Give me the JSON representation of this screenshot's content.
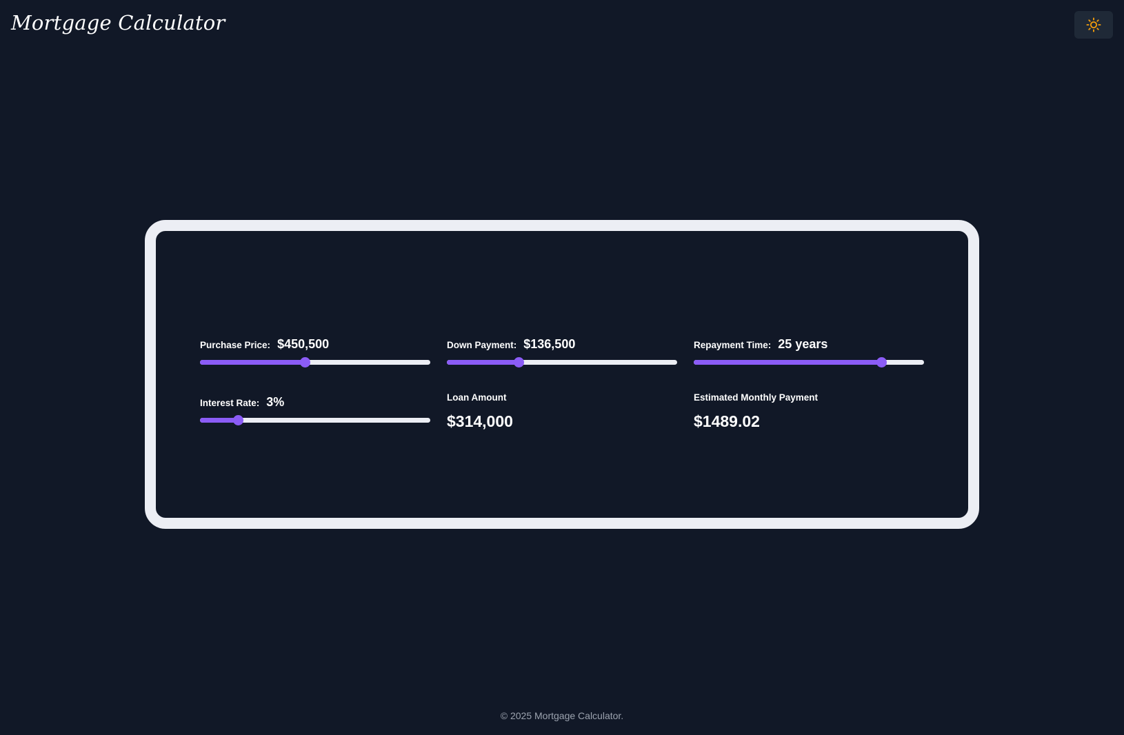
{
  "header": {
    "title": "Mortgage Calculator",
    "theme_toggle_icon": "sun-icon",
    "theme_toggle_color": "#f59e0b"
  },
  "calculator": {
    "purchase_price": {
      "label": "Purchase Price:",
      "value": "$450,500",
      "slider_fraction": 0.455
    },
    "down_payment": {
      "label": "Down Payment:",
      "value": "$136,500",
      "slider_fraction": 0.31
    },
    "repayment_time": {
      "label": "Repayment Time:",
      "value": "25 years",
      "slider_fraction": 0.815
    },
    "interest_rate": {
      "label": "Interest Rate:",
      "value": "3%",
      "slider_fraction": 0.165
    },
    "loan_amount": {
      "label": "Loan Amount",
      "value": "$314,000"
    },
    "monthly_payment": {
      "label": "Estimated Monthly Payment",
      "value": "$1489.02"
    }
  },
  "colors": {
    "background": "#111827",
    "accent": "#8b5cf6",
    "card_border": "#eceef4"
  },
  "footer": {
    "text": "© 2025 Mortgage Calculator."
  }
}
